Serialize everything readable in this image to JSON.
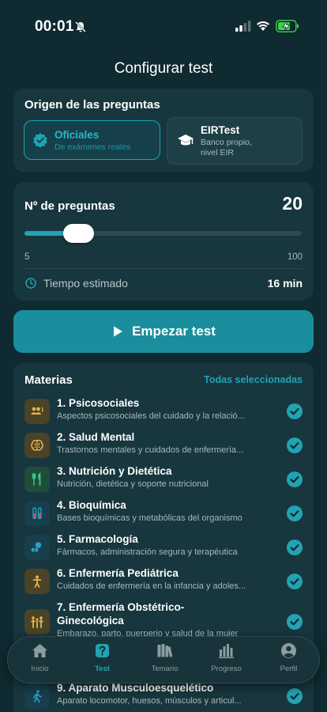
{
  "status": {
    "time": "00:01"
  },
  "title": "Configurar test",
  "origin": {
    "heading": "Origen de las preguntas",
    "official": {
      "title": "Oficiales",
      "subtitle": "De exámenes reales"
    },
    "eir": {
      "title": "EIRTest",
      "subtitle1": "Banco propio,",
      "subtitle2": "nivel EIR"
    }
  },
  "questions": {
    "label": "Nº de preguntas",
    "value": "20",
    "min": "5",
    "max": "100",
    "time_label": "Tiempo estimado",
    "time_value": "16 min"
  },
  "start_button": "Empezar test",
  "subjects": {
    "heading": "Materias",
    "all_selected": "Todas seleccionadas",
    "items": [
      {
        "name": "1. Psicosociales",
        "desc": "Aspectos psicosociales del cuidado y la relació...",
        "icon": "people-talk-icon",
        "color": "#4a4327",
        "tint": "#e8b44a"
      },
      {
        "name": "2. Salud Mental",
        "desc": "Trastornos mentales y cuidados de enfermería...",
        "icon": "brain-icon",
        "color": "#4a4327",
        "tint": "#e8b44a"
      },
      {
        "name": "3. Nutrición y Dietética",
        "desc": "Nutrición, dietética y soporte nutricional",
        "icon": "cutlery-icon",
        "color": "#1e4e3a",
        "tint": "#3fc486"
      },
      {
        "name": "4. Bioquímica",
        "desc": "Bases bioquímicas y metabólicas del organismo",
        "icon": "test-tubes-icon",
        "color": "#173f4d",
        "tint": "#2a9fc0"
      },
      {
        "name": "5. Farmacología",
        "desc": "Fármacos, administración segura y terapéutica",
        "icon": "pills-icon",
        "color": "#173f4d",
        "tint": "#2a9fc0"
      },
      {
        "name": "6. Enfermería Pediátrica",
        "desc": "Cuidados de enfermería en la infancia y adoles...",
        "icon": "child-icon",
        "color": "#4a4327",
        "tint": "#e8b44a"
      },
      {
        "name": "7. Enfermería Obstétrico-",
        "name2": "Ginecológica",
        "desc": "Embarazo, parto, puerperio y salud de la mujer",
        "icon": "family-icon",
        "color": "#4a4327",
        "tint": "#e8b44a"
      },
      {
        "name": "9. Aparato Musculoesquelético",
        "desc": "Aparato locomotor, huesos, músculos y articul...",
        "icon": "walking-icon",
        "color": "#173f4d",
        "tint": "#2a9fc0"
      }
    ]
  },
  "nav": [
    {
      "label": "Inicio",
      "icon": "home-icon"
    },
    {
      "label": "Test",
      "icon": "question-icon"
    },
    {
      "label": "Temario",
      "icon": "books-icon"
    },
    {
      "label": "Progreso",
      "icon": "bar-chart-icon"
    },
    {
      "label": "Perfil",
      "icon": "user-icon"
    }
  ],
  "colors": {
    "accent": "#22a3b3",
    "background": "#0f2a30",
    "card": "#17363d",
    "button": "#1a8e9d"
  },
  "slider_fraction": 0.16
}
